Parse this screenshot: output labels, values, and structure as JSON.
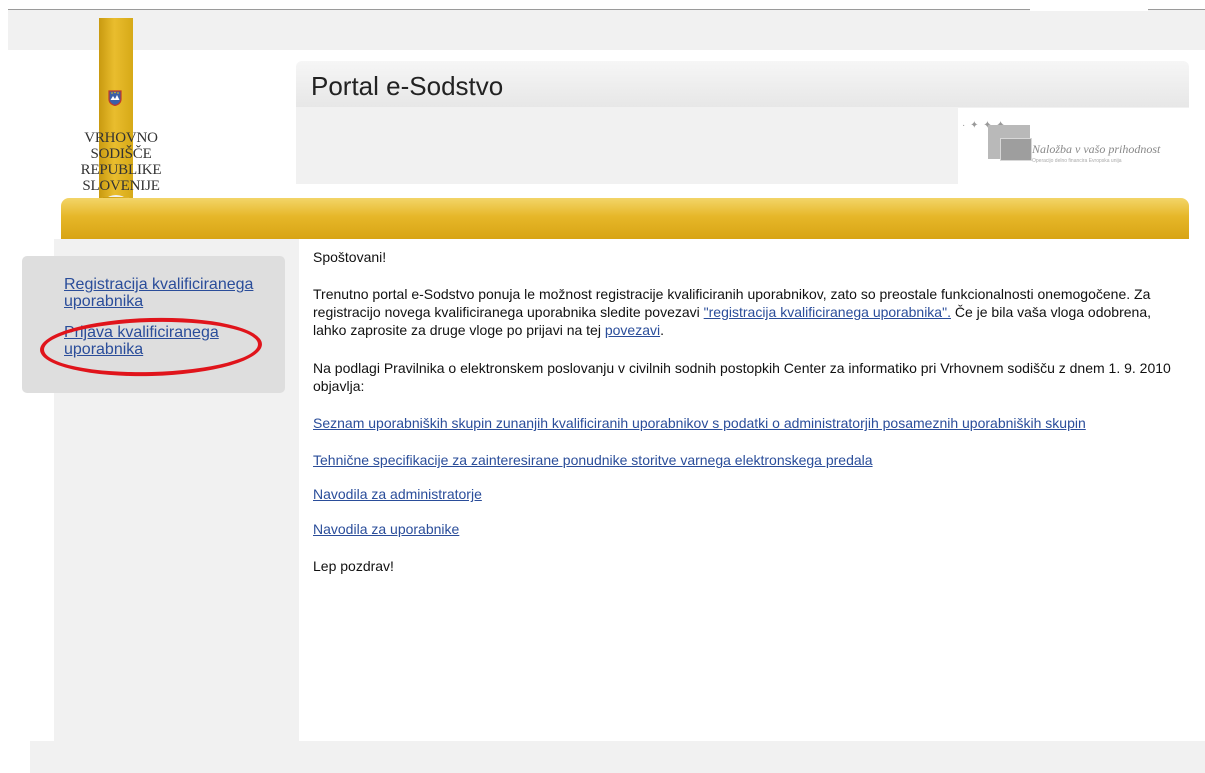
{
  "logo": {
    "court_name_line1": "VRHOVNO SODIŠČE",
    "court_name_line2": "REPUBLIKE SLOVENIJE",
    "coat_icon": "slovenia-coat-of-arms-icon",
    "ribbon_color": "#e0b22a"
  },
  "header": {
    "title": "Portal e-Sodstvo",
    "eu_slogan": "Naložba v vašo prihodnost",
    "eu_subtext": "Operacijo delno financira Evropska unija"
  },
  "sidebar": {
    "items": [
      {
        "label": "Registracija kvalificiranega uporabnika"
      },
      {
        "label": "Prijava kvalificiranega uporabnika"
      }
    ]
  },
  "main": {
    "greeting": "Spoštovani!",
    "intro_text": "Trenutno portal e-Sodstvo ponuja le možnost registracije kvalificiranih uporabnikov, zato so preostale funkcionalnosti onemogočene. Za registracijo novega kvalificiranega uporabnika sledite povezavi ",
    "intro_link": "\"registracija kvalificiranega uporabnika\".",
    "intro_text2": " Če je bila vaša vloga odobrena, lahko zaprosite za druge vloge po prijavi na tej ",
    "intro_link2": "povezavi",
    "intro_end": ".",
    "rules_text": "Na podlagi Pravilnika o elektronskem poslovanju v civilnih sodnih postopkih Center za informatiko pri Vrhovnem sodišču z dnem 1. 9. 2010 objavlja:",
    "links": [
      "Seznam uporabniških skupin zunanjih kvalificiranih  uporabnikov s podatki o administratorjih posameznih uporabniških skupin",
      "Tehnične specifikacije za zainteresirane ponudnike storitve varnega elektronskega predala",
      "Navodila za administratorje",
      "Navodila za uporabnike"
    ],
    "closing": "Lep pozdrav!"
  },
  "colors": {
    "link": "#2a4d9a",
    "gold_bar": "#e6b729",
    "highlight_ellipse": "#e0141b"
  }
}
